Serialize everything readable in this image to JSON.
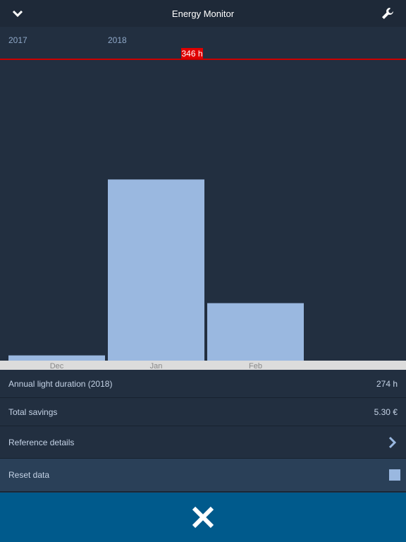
{
  "header": {
    "title": "Energy Monitor",
    "back_icon": "chevron-down-icon",
    "settings_icon": "wrench-icon"
  },
  "years": [
    "2017",
    "2018"
  ],
  "chart_data": {
    "type": "bar",
    "categories": [
      "Dec",
      "Jan",
      "Feb"
    ],
    "values": [
      6,
      208,
      66
    ],
    "unit": "h",
    "ylim": [
      0,
      346
    ],
    "max_line_label": "346 h",
    "bar_color": "#9ab8e0",
    "max_line_color": "#cc0000"
  },
  "rows": [
    {
      "label": "Annual light duration (2018)",
      "value": "274 h"
    },
    {
      "label": "Total savings",
      "value": "5.30 €"
    },
    {
      "label": "Reference details",
      "icon": "chevron-right-icon"
    },
    {
      "label": "Reset data",
      "icon": "checkbox"
    }
  ],
  "footer": {
    "close_icon": "close-icon"
  }
}
